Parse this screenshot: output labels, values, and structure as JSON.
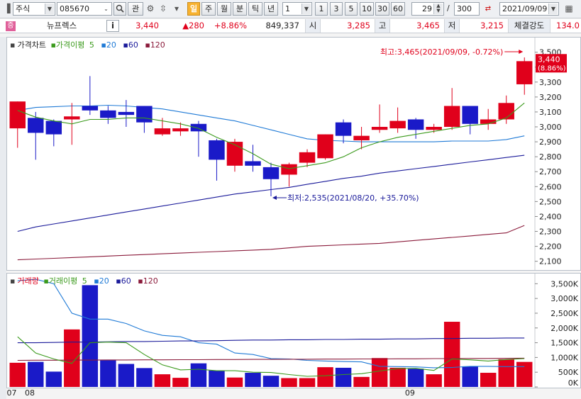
{
  "toolbar": {
    "market_type": "주식",
    "stock_code": "085670",
    "relation_button": "관",
    "period_buttons": [
      {
        "label": "일",
        "selected": true
      },
      {
        "label": "주",
        "selected": false
      },
      {
        "label": "월",
        "selected": false
      },
      {
        "label": "분",
        "selected": false
      },
      {
        "label": "틱",
        "selected": false
      },
      {
        "label": "년",
        "selected": false
      }
    ],
    "interval_value": "1",
    "interval_buttons": [
      "1",
      "3",
      "5",
      "10",
      "30",
      "60"
    ],
    "display_count": "29",
    "separator": "/",
    "total_count": "300",
    "date": "2021/09/09",
    "accent_color": "#f7b230"
  },
  "quote": {
    "badge": "증",
    "stock_name": "뉴프렉스",
    "info_button": "i",
    "price": "3,440",
    "change": "▲280",
    "change_pct": "+8.86%",
    "volume": "849,337",
    "open_label": "시",
    "open": "3,285",
    "high_label": "고",
    "high": "3,465",
    "low_label": "저",
    "low": "3,215",
    "strength_label": "체결강도",
    "strength": "134.0"
  },
  "price_legend": {
    "title": "가격차트",
    "ma_label": "가격이평",
    "periods": [
      "5",
      "20",
      "60",
      "120"
    ]
  },
  "volume_legend": {
    "title": "거래량",
    "ma_label": "거래이평",
    "periods": [
      "5",
      "20",
      "60",
      "120"
    ]
  },
  "colors": {
    "up": "#e0001b",
    "down": "#1a1ac8",
    "ma5": "#3b9a1c",
    "ma20": "#1f7ad6",
    "ma60": "#1a1a9a",
    "ma120": "#8a1a3a"
  },
  "annotations": {
    "high": "최고:3,465(2021/09/09, -0.72%)",
    "low": "최저:2,535(2021/08/20, +35.70%)",
    "current_price": "3,440",
    "current_pct": "(8.86%)"
  },
  "x_labels": [
    {
      "label": "07",
      "index": 0
    },
    {
      "label": "08",
      "index": 1
    },
    {
      "label": "09",
      "index": 22
    }
  ],
  "chart_data": [
    {
      "type": "candlestick",
      "y_ticks": [
        2100,
        2200,
        2300,
        2400,
        2500,
        2600,
        2700,
        2800,
        2900,
        3000,
        3100,
        3200,
        3300,
        3400,
        3500
      ],
      "ylim": [
        2070,
        3560
      ],
      "candles": [
        {
          "o": 2990,
          "c": 3170,
          "h": 3170,
          "l": 2860
        },
        {
          "o": 3060,
          "c": 2960,
          "h": 3100,
          "l": 2780
        },
        {
          "o": 3040,
          "c": 2950,
          "h": 3050,
          "l": 2870
        },
        {
          "o": 3050,
          "c": 3070,
          "h": 3160,
          "l": 2880
        },
        {
          "o": 3140,
          "c": 3110,
          "h": 3340,
          "l": 3080
        },
        {
          "o": 3110,
          "c": 3060,
          "h": 3140,
          "l": 3020
        },
        {
          "o": 3100,
          "c": 3080,
          "h": 3180,
          "l": 3000
        },
        {
          "o": 3140,
          "c": 3030,
          "h": 3140,
          "l": 2960
        },
        {
          "o": 2950,
          "c": 2990,
          "h": 3060,
          "l": 2940
        },
        {
          "o": 2970,
          "c": 2990,
          "h": 3030,
          "l": 2940
        },
        {
          "o": 3020,
          "c": 2970,
          "h": 3040,
          "l": 2800
        },
        {
          "o": 2910,
          "c": 2780,
          "h": 2920,
          "l": 2640
        },
        {
          "o": 2740,
          "c": 2900,
          "h": 2920,
          "l": 2700
        },
        {
          "o": 2770,
          "c": 2740,
          "h": 2880,
          "l": 2700
        },
        {
          "o": 2730,
          "c": 2650,
          "h": 2760,
          "l": 2535
        },
        {
          "o": 2680,
          "c": 2750,
          "h": 2760,
          "l": 2600
        },
        {
          "o": 2760,
          "c": 2830,
          "h": 2850,
          "l": 2730
        },
        {
          "o": 2790,
          "c": 2950,
          "h": 2950,
          "l": 2780
        },
        {
          "o": 3030,
          "c": 2940,
          "h": 3050,
          "l": 2890
        },
        {
          "o": 2910,
          "c": 2940,
          "h": 3000,
          "l": 2850
        },
        {
          "o": 2980,
          "c": 3000,
          "h": 3150,
          "l": 2960
        },
        {
          "o": 2990,
          "c": 3040,
          "h": 3130,
          "l": 2960
        },
        {
          "o": 3050,
          "c": 2980,
          "h": 3060,
          "l": 2920
        },
        {
          "o": 2980,
          "c": 3000,
          "h": 3020,
          "l": 2960
        },
        {
          "o": 3000,
          "c": 3140,
          "h": 3260,
          "l": 2980
        },
        {
          "o": 3140,
          "c": 3020,
          "h": 3140,
          "l": 2950
        },
        {
          "o": 3020,
          "c": 3050,
          "h": 3120,
          "l": 2980
        },
        {
          "o": 3050,
          "c": 3160,
          "h": 3210,
          "l": 3020
        },
        {
          "o": 3285,
          "c": 3440,
          "h": 3465,
          "l": 3215
        }
      ],
      "ma5": [
        3110,
        3065,
        3040,
        3020,
        3050,
        3050,
        3060,
        3060,
        3040,
        3020,
        2990,
        2930,
        2880,
        2820,
        2750,
        2720,
        2740,
        2760,
        2800,
        2860,
        2900,
        2930,
        2950,
        2970,
        2990,
        3010,
        3020,
        3060,
        3160
      ],
      "ma20": [
        3110,
        3130,
        3135,
        3140,
        3140,
        3145,
        3140,
        3130,
        3120,
        3100,
        3080,
        3060,
        3040,
        3010,
        2980,
        2950,
        2920,
        2910,
        2905,
        2900,
        2900,
        2900,
        2900,
        2900,
        2905,
        2905,
        2905,
        2915,
        2940
      ],
      "ma60": [
        2300,
        2330,
        2350,
        2370,
        2390,
        2410,
        2430,
        2450,
        2470,
        2490,
        2510,
        2530,
        2550,
        2565,
        2580,
        2595,
        2615,
        2635,
        2655,
        2670,
        2690,
        2705,
        2720,
        2735,
        2750,
        2765,
        2780,
        2795,
        2810
      ],
      "ma120": [
        2110,
        2115,
        2120,
        2125,
        2130,
        2135,
        2140,
        2145,
        2150,
        2155,
        2160,
        2165,
        2170,
        2175,
        2180,
        2190,
        2200,
        2205,
        2210,
        2215,
        2220,
        2230,
        2240,
        2250,
        2260,
        2270,
        2280,
        2290,
        2340
      ]
    },
    {
      "type": "bar",
      "unit": "volume",
      "y_ticks": [
        {
          "value": 0,
          "label": "0K"
        },
        {
          "value": 500000,
          "label": "500K"
        },
        {
          "value": 1000000,
          "label": "1,000K"
        },
        {
          "value": 1500000,
          "label": "1,500K"
        },
        {
          "value": 2000000,
          "label": "2,000K"
        },
        {
          "value": 2500000,
          "label": "2,500K"
        },
        {
          "value": 3000000,
          "label": "3,000K"
        },
        {
          "value": 3500000,
          "label": "3,500K"
        }
      ],
      "ylim": [
        0,
        3700000
      ],
      "values": [
        820000,
        850000,
        520000,
        1950000,
        3450000,
        900000,
        780000,
        640000,
        430000,
        310000,
        800000,
        560000,
        320000,
        480000,
        380000,
        300000,
        300000,
        670000,
        650000,
        340000,
        980000,
        650000,
        620000,
        430000,
        2210000,
        700000,
        480000,
        940000,
        849337
      ],
      "ma5": [
        1700,
        1150,
        950,
        800,
        1500,
        1520,
        1500,
        1100,
        750,
        580,
        600,
        550,
        550,
        500,
        490,
        420,
        360,
        380,
        420,
        450,
        540,
        620,
        630,
        560,
        950,
        920,
        880,
        930,
        960
      ],
      "ma20": [
        3600,
        3650,
        3500,
        2500,
        2300,
        2300,
        2150,
        1900,
        1750,
        1700,
        1500,
        1450,
        1150,
        1100,
        960,
        950,
        900,
        880,
        860,
        850,
        700,
        690,
        680,
        650,
        660,
        700,
        700,
        690,
        690
      ],
      "ma60": [
        1500,
        1500,
        1510,
        1520,
        1520,
        1530,
        1540,
        1540,
        1550,
        1560,
        1560,
        1570,
        1580,
        1590,
        1590,
        1600,
        1600,
        1610,
        1610,
        1620,
        1620,
        1630,
        1630,
        1640,
        1640,
        1650,
        1650,
        1660,
        1660
      ],
      "ma120": [
        900,
        905,
        905,
        910,
        910,
        915,
        915,
        920,
        920,
        925,
        925,
        930,
        930,
        935,
        935,
        940,
        940,
        945,
        945,
        950,
        950,
        955,
        955,
        960,
        960,
        965,
        965,
        970,
        975
      ]
    }
  ]
}
